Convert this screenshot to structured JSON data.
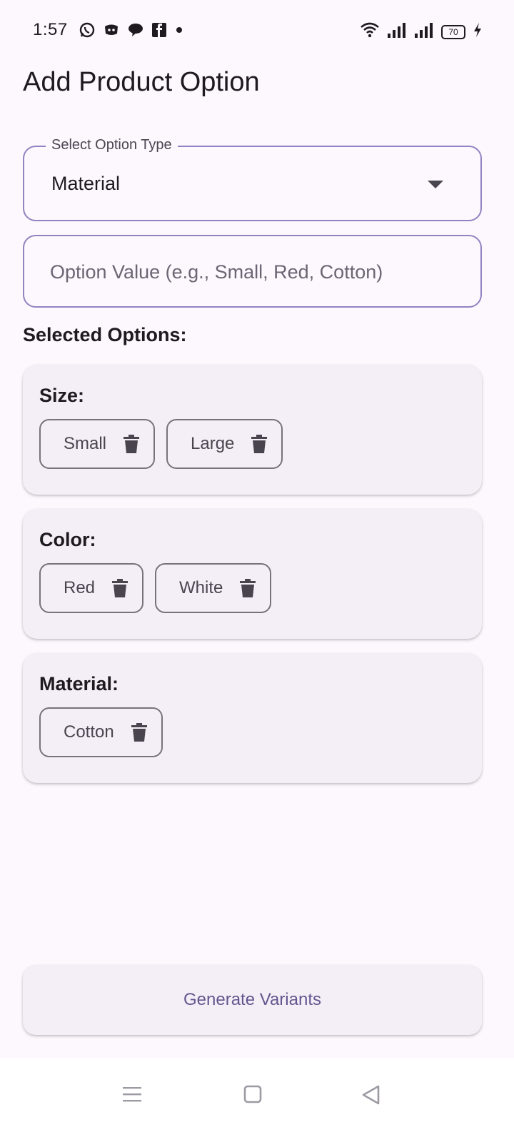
{
  "status_bar": {
    "time": "1:57",
    "battery_level": "70",
    "notification_icons": [
      "whatsapp-icon",
      "discord-icon",
      "chat-bubble-icon",
      "facebook-icon",
      "dot-icon"
    ],
    "system_icons": [
      "wifi-icon",
      "signal-icon",
      "signal-icon",
      "battery-icon",
      "charging-icon"
    ]
  },
  "header": {
    "title": "Add Product Option"
  },
  "option_type_dropdown": {
    "label": "Select Option Type",
    "selected_value": "Material"
  },
  "option_value_input": {
    "value": "",
    "placeholder": "Option Value (e.g., Small, Red, Cotton)"
  },
  "selected_options": {
    "heading": "Selected Options:",
    "groups": [
      {
        "title": "Size:",
        "values": [
          "Small",
          "Large"
        ]
      },
      {
        "title": "Color:",
        "values": [
          "Red",
          "White"
        ]
      },
      {
        "title": "Material:",
        "values": [
          "Cotton"
        ]
      }
    ]
  },
  "actions": {
    "generate_label": "Generate Variants"
  },
  "colors": {
    "background": "#fdf7fe",
    "outline": "#8f84c1",
    "card": "#f4eff6",
    "accent": "#65558f",
    "chip_border": "#77737c"
  }
}
